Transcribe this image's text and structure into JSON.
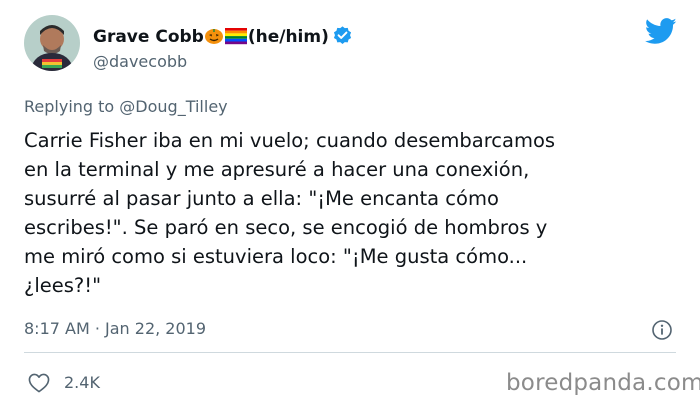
{
  "author": {
    "display_name": "Grave Cobb",
    "pronouns": "(he/him)",
    "handle": "@davecobb"
  },
  "reply": {
    "prefix": "Replying to",
    "target": "@Doug_Tilley"
  },
  "tweet": {
    "text": "Carrie Fisher iba en mi vuelo; cuando desembarcamos\nen la terminal y me apresuré a hacer una conexión,\nsusurré al pasar junto a ella: \"¡Me encanta cómo\nescribes!\". Se paró en seco, se encogió de hombros y\nme miró como si estuviera loco: \"¡Me gusta cómo...\n¿lees?!\"",
    "timestamp": "8:17 AM · Jan 22, 2019",
    "likes": "2.4K"
  },
  "watermark": "boredpanda.com",
  "colors": {
    "twitter_blue": "#1d9bf0",
    "secondary_text": "#536471"
  }
}
